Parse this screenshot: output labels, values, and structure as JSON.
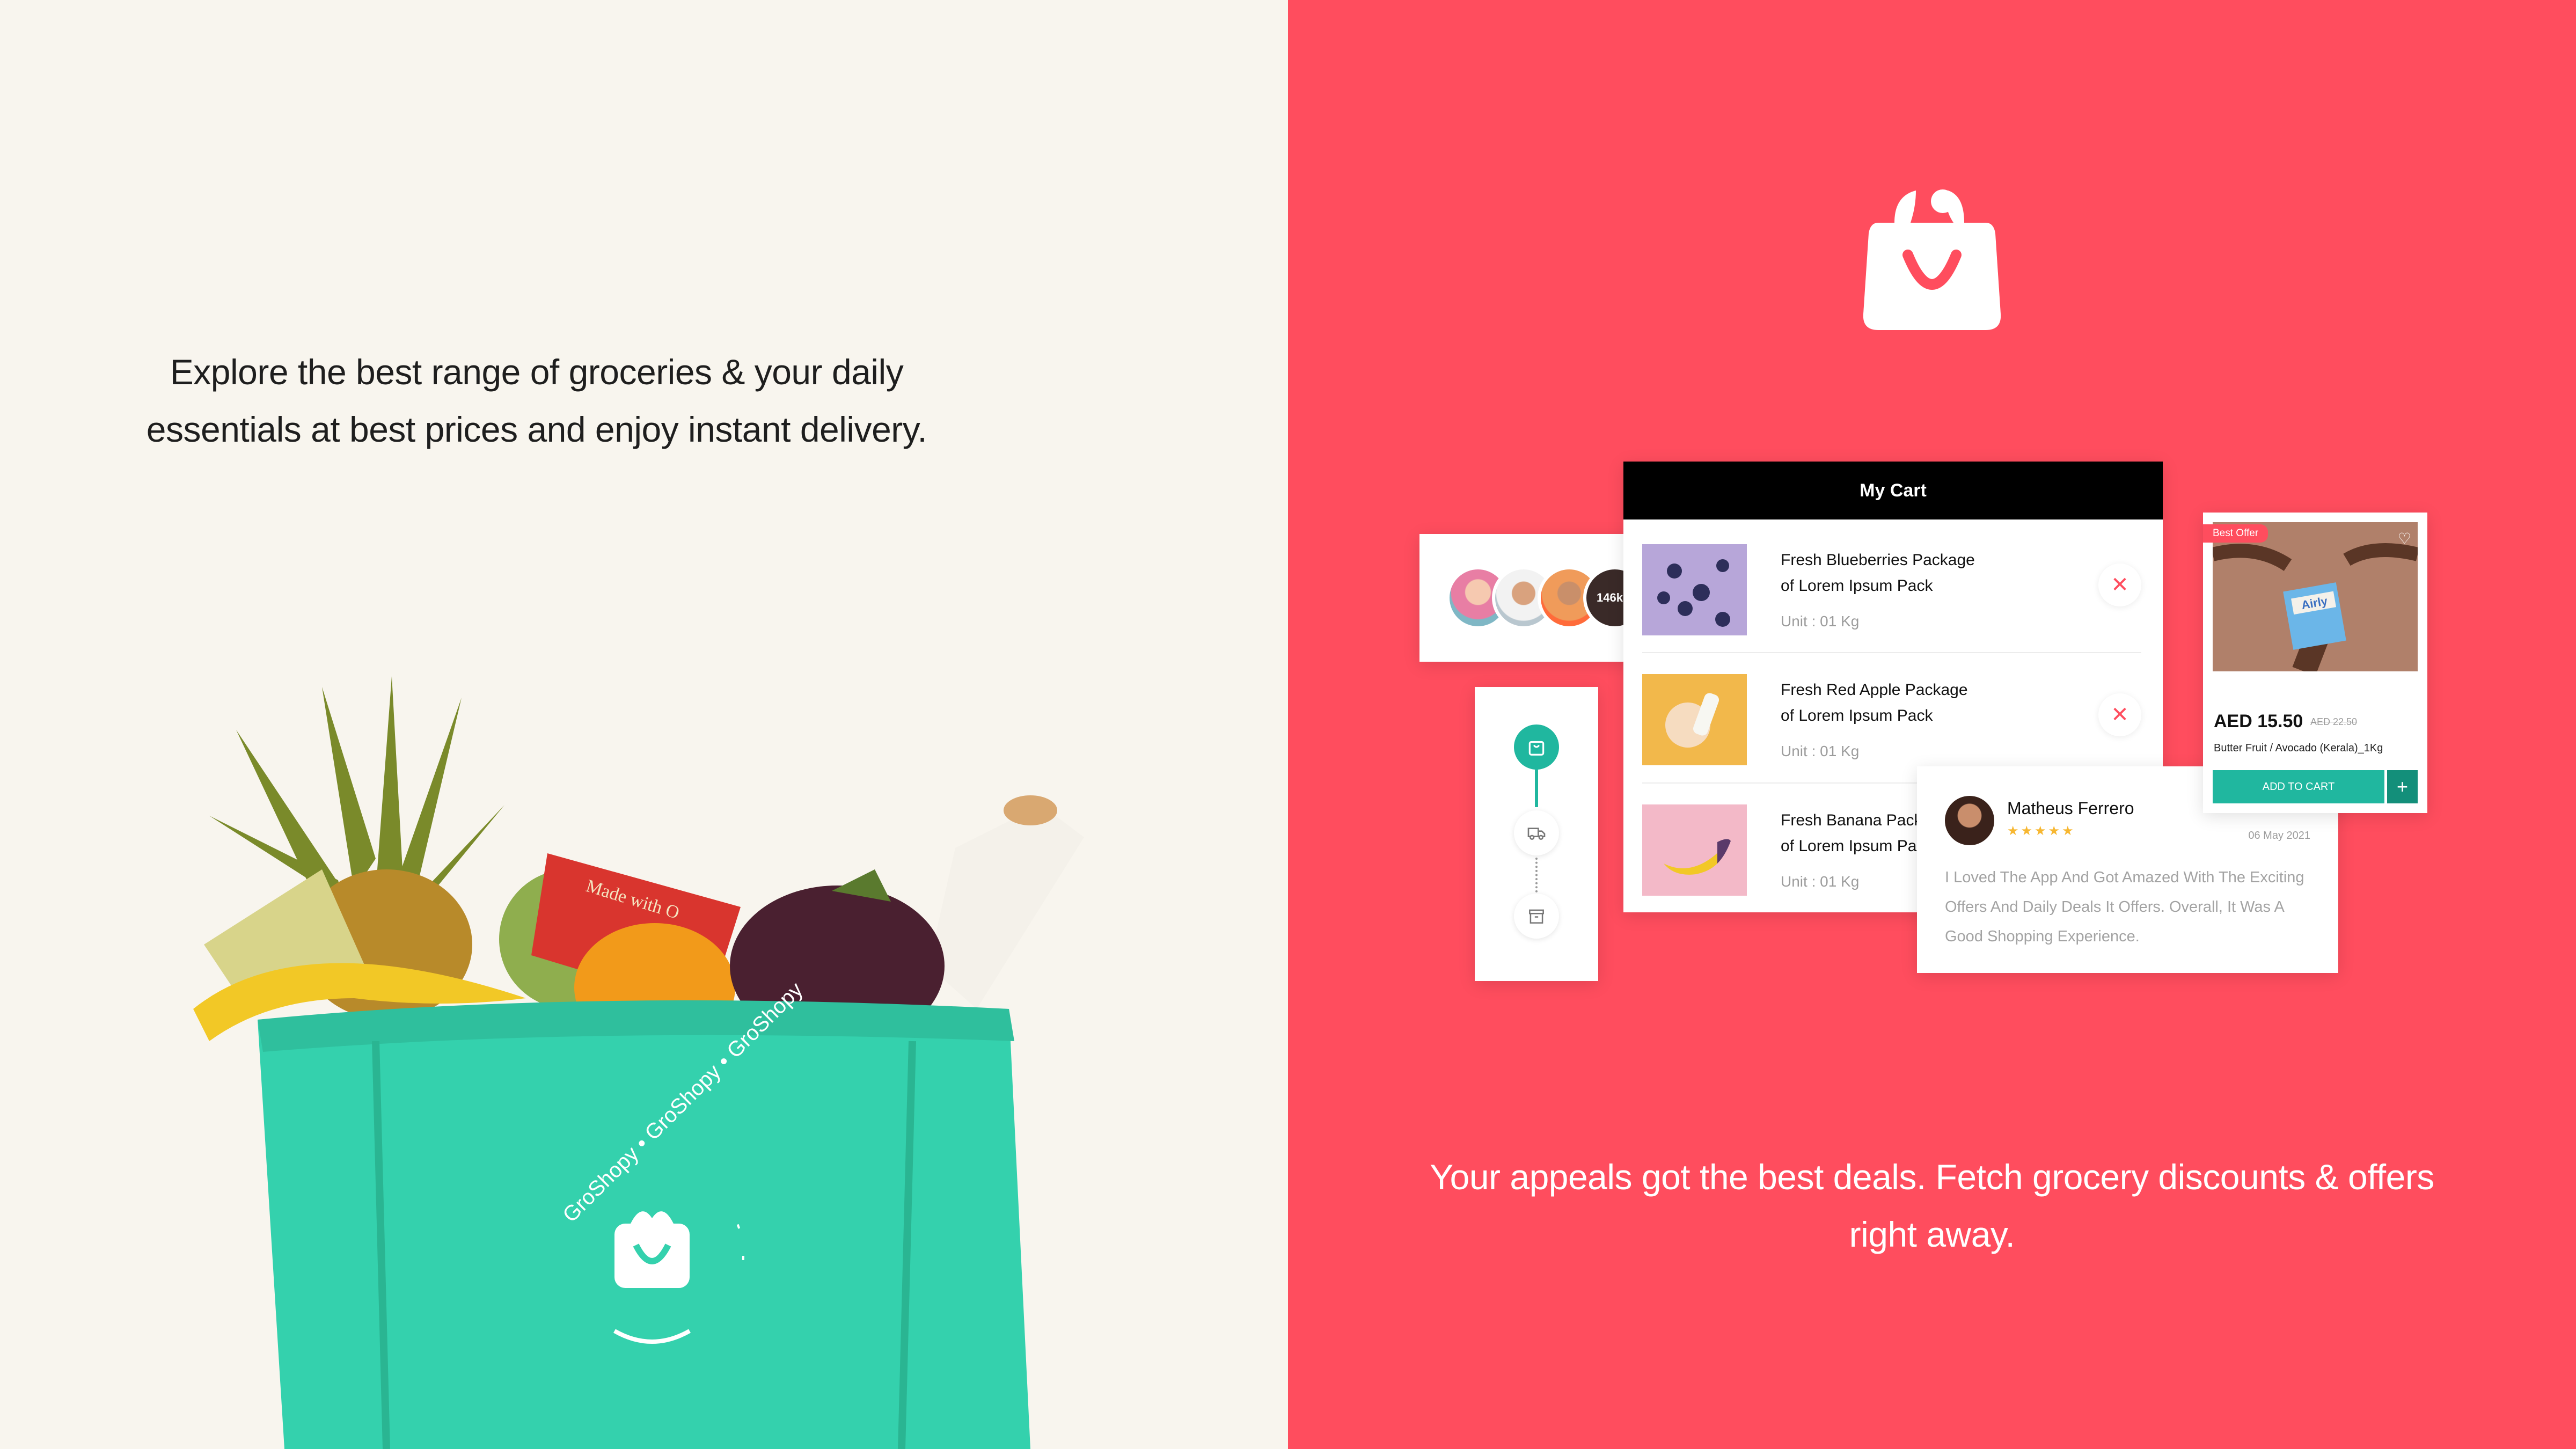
{
  "left_panel": {
    "tagline": "Explore the best range of groceries & your daily essentials at best prices and enjoy instant delivery.",
    "bag": {
      "brand_ring": "GroShopy • GroShopy • GroShopy",
      "package_text": "Made with O"
    }
  },
  "right_panel": {
    "logo_icon": "shopping-bag-icon",
    "tagline": "Your appeals got the best deals. Fetch grocery discounts & offers right away.",
    "avatars": {
      "count_label": "146k +"
    },
    "order_tracker": {
      "steps": [
        "cart-icon",
        "truck-icon",
        "box-icon"
      ]
    },
    "cart": {
      "title": "My Cart",
      "items": [
        {
          "title_line1": "Fresh Blueberries Package",
          "title_line2": "of Lorem Ipsum Pack",
          "unit": "Unit : 01 Kg"
        },
        {
          "title_line1": "Fresh Red Apple Package",
          "title_line2": "of Lorem Ipsum Pack",
          "unit": "Unit : 01 Kg"
        },
        {
          "title_line1": "Fresh Banana Packa",
          "title_line2": "of Lorem Ipsum Pack",
          "unit": "Unit : 01 Kg"
        }
      ],
      "remove_symbol": "✕"
    },
    "review": {
      "name": "Matheus Ferrero",
      "stars": "★★★★★",
      "date": "06 May 2021",
      "text": "I Loved The App And Got Amazed With The Exciting Offers And Daily Deals It Offers. Overall, It Was A Good Shopping Experience."
    },
    "offer": {
      "badge": "Best Offer",
      "price": "AED 15.50",
      "old_price": "AED 22.50",
      "product_name": "Butter Fruit / Avocado (Kerala)_1Kg",
      "button": "ADD TO CART",
      "plus": "+",
      "package_brand": "Airly"
    }
  },
  "colors": {
    "left_bg": "#f8f5ee",
    "right_bg": "#ff4d5e",
    "teal": "#20b79f",
    "bag_green": "#34d1ad"
  }
}
